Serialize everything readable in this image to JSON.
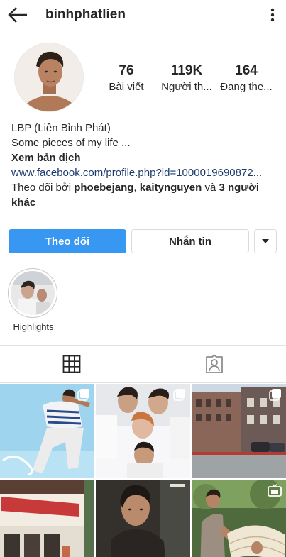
{
  "header": {
    "username": "binhphatlien",
    "back_icon": "arrow-left-icon",
    "more_icon": "kebab-menu-icon"
  },
  "stats": {
    "posts": {
      "value": "76",
      "label": "Bài viết"
    },
    "followers": {
      "value": "119K",
      "label": "Người th..."
    },
    "following": {
      "value": "164",
      "label": "Đang the..."
    }
  },
  "bio": {
    "display_name": "LBP (Liên Bỉnh Phát)",
    "text": "Some pieces of my life ...",
    "translate": "Xem bản dịch",
    "link": "www.facebook.com/profile.php?id=1000019690872...",
    "followed_by_prefix": "Theo dõi bởi ",
    "follower1": "phoebejang",
    "separator": ", ",
    "follower2": "kaitynguyen",
    "and": " và ",
    "others": "3 người khác"
  },
  "actions": {
    "follow": "Theo dõi",
    "message": "Nhắn tin",
    "dropdown_icon": "caret-down-icon"
  },
  "highlights": [
    {
      "label": "Highlights"
    }
  ],
  "tabs": [
    {
      "name": "grid",
      "icon": "grid-icon",
      "active": true
    },
    {
      "name": "tagged",
      "icon": "tagged-person-icon",
      "active": false
    }
  ],
  "colors": {
    "accent": "#3897f0",
    "link": "#1a3a6e",
    "text": "#262626",
    "border": "#dbdbdb"
  }
}
